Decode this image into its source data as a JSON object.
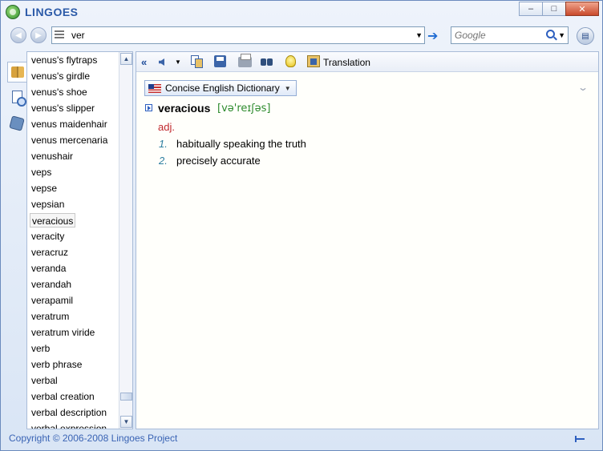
{
  "app": {
    "title": "LINGOES"
  },
  "window_controls": {
    "minimize": "–",
    "maximize": "□",
    "close": "✕"
  },
  "navigation": {
    "back_glyph": "◀",
    "forward_glyph": "▶",
    "address_value": "ver",
    "search_placeholder": "Google"
  },
  "word_list": {
    "selected": "veracious",
    "items": [
      "venus's flytraps",
      "venus's girdle",
      "venus's shoe",
      "venus's slipper",
      "venus maidenhair",
      "venus mercenaria",
      "venushair",
      "veps",
      "vepse",
      "vepsian",
      "veracious",
      "veracity",
      "veracruz",
      "veranda",
      "verandah",
      "verapamil",
      "veratrum",
      "veratrum viride",
      "verb",
      "verb phrase",
      "verbal",
      "verbal creation",
      "verbal description",
      "verbal expression"
    ]
  },
  "content_toolbar": {
    "translation_label": "Translation"
  },
  "dictionary": {
    "name": "Concise English Dictionary"
  },
  "entry": {
    "headword": "veracious",
    "phonetic": "[və'reɪʃəs]",
    "part_of_speech": "adj.",
    "definitions": [
      {
        "num": "1.",
        "text": "habitually speaking the truth"
      },
      {
        "num": "2.",
        "text": "precisely accurate"
      }
    ]
  },
  "status": {
    "copyright": "Copyright © 2006-2008 Lingoes Project"
  },
  "colors": {
    "accent": "#2b5aa8",
    "headword_pos": "#c0282d",
    "phonetic": "#2e8b2e",
    "status_text": "#3a64b4"
  }
}
